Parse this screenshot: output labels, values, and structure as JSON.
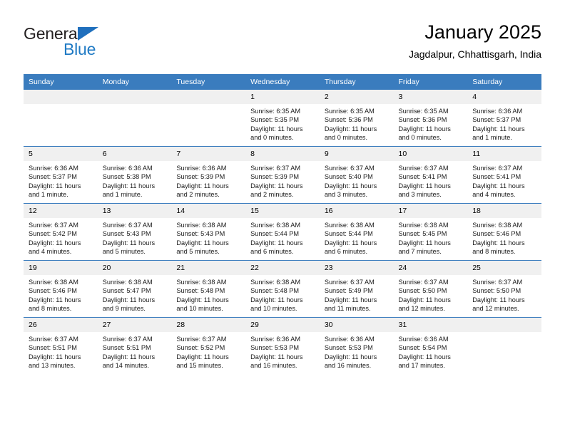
{
  "logo": {
    "word_top": "General",
    "word_bottom": "Blue",
    "triangle": "triangle-icon",
    "color_dark": "#231f20",
    "color_blue": "#1f7ac4"
  },
  "header": {
    "title": "January 2025",
    "subtitle": "Jagdalpur, Chhattisgarh, India"
  },
  "theme": {
    "header_bar": "#3a7cbe",
    "daynum_band": "#f0f0f0",
    "text": "#000000"
  },
  "weekday_headers": [
    "Sunday",
    "Monday",
    "Tuesday",
    "Wednesday",
    "Thursday",
    "Friday",
    "Saturday"
  ],
  "weeks": [
    [
      {
        "day": "",
        "sunrise": "",
        "sunset": "",
        "daylight1": "",
        "daylight2": ""
      },
      {
        "day": "",
        "sunrise": "",
        "sunset": "",
        "daylight1": "",
        "daylight2": ""
      },
      {
        "day": "",
        "sunrise": "",
        "sunset": "",
        "daylight1": "",
        "daylight2": ""
      },
      {
        "day": "1",
        "sunrise": "Sunrise: 6:35 AM",
        "sunset": "Sunset: 5:35 PM",
        "daylight1": "Daylight: 11 hours",
        "daylight2": "and 0 minutes."
      },
      {
        "day": "2",
        "sunrise": "Sunrise: 6:35 AM",
        "sunset": "Sunset: 5:36 PM",
        "daylight1": "Daylight: 11 hours",
        "daylight2": "and 0 minutes."
      },
      {
        "day": "3",
        "sunrise": "Sunrise: 6:35 AM",
        "sunset": "Sunset: 5:36 PM",
        "daylight1": "Daylight: 11 hours",
        "daylight2": "and 0 minutes."
      },
      {
        "day": "4",
        "sunrise": "Sunrise: 6:36 AM",
        "sunset": "Sunset: 5:37 PM",
        "daylight1": "Daylight: 11 hours",
        "daylight2": "and 1 minute."
      }
    ],
    [
      {
        "day": "5",
        "sunrise": "Sunrise: 6:36 AM",
        "sunset": "Sunset: 5:37 PM",
        "daylight1": "Daylight: 11 hours",
        "daylight2": "and 1 minute."
      },
      {
        "day": "6",
        "sunrise": "Sunrise: 6:36 AM",
        "sunset": "Sunset: 5:38 PM",
        "daylight1": "Daylight: 11 hours",
        "daylight2": "and 1 minute."
      },
      {
        "day": "7",
        "sunrise": "Sunrise: 6:36 AM",
        "sunset": "Sunset: 5:39 PM",
        "daylight1": "Daylight: 11 hours",
        "daylight2": "and 2 minutes."
      },
      {
        "day": "8",
        "sunrise": "Sunrise: 6:37 AM",
        "sunset": "Sunset: 5:39 PM",
        "daylight1": "Daylight: 11 hours",
        "daylight2": "and 2 minutes."
      },
      {
        "day": "9",
        "sunrise": "Sunrise: 6:37 AM",
        "sunset": "Sunset: 5:40 PM",
        "daylight1": "Daylight: 11 hours",
        "daylight2": "and 3 minutes."
      },
      {
        "day": "10",
        "sunrise": "Sunrise: 6:37 AM",
        "sunset": "Sunset: 5:41 PM",
        "daylight1": "Daylight: 11 hours",
        "daylight2": "and 3 minutes."
      },
      {
        "day": "11",
        "sunrise": "Sunrise: 6:37 AM",
        "sunset": "Sunset: 5:41 PM",
        "daylight1": "Daylight: 11 hours",
        "daylight2": "and 4 minutes."
      }
    ],
    [
      {
        "day": "12",
        "sunrise": "Sunrise: 6:37 AM",
        "sunset": "Sunset: 5:42 PM",
        "daylight1": "Daylight: 11 hours",
        "daylight2": "and 4 minutes."
      },
      {
        "day": "13",
        "sunrise": "Sunrise: 6:37 AM",
        "sunset": "Sunset: 5:43 PM",
        "daylight1": "Daylight: 11 hours",
        "daylight2": "and 5 minutes."
      },
      {
        "day": "14",
        "sunrise": "Sunrise: 6:38 AM",
        "sunset": "Sunset: 5:43 PM",
        "daylight1": "Daylight: 11 hours",
        "daylight2": "and 5 minutes."
      },
      {
        "day": "15",
        "sunrise": "Sunrise: 6:38 AM",
        "sunset": "Sunset: 5:44 PM",
        "daylight1": "Daylight: 11 hours",
        "daylight2": "and 6 minutes."
      },
      {
        "day": "16",
        "sunrise": "Sunrise: 6:38 AM",
        "sunset": "Sunset: 5:44 PM",
        "daylight1": "Daylight: 11 hours",
        "daylight2": "and 6 minutes."
      },
      {
        "day": "17",
        "sunrise": "Sunrise: 6:38 AM",
        "sunset": "Sunset: 5:45 PM",
        "daylight1": "Daylight: 11 hours",
        "daylight2": "and 7 minutes."
      },
      {
        "day": "18",
        "sunrise": "Sunrise: 6:38 AM",
        "sunset": "Sunset: 5:46 PM",
        "daylight1": "Daylight: 11 hours",
        "daylight2": "and 8 minutes."
      }
    ],
    [
      {
        "day": "19",
        "sunrise": "Sunrise: 6:38 AM",
        "sunset": "Sunset: 5:46 PM",
        "daylight1": "Daylight: 11 hours",
        "daylight2": "and 8 minutes."
      },
      {
        "day": "20",
        "sunrise": "Sunrise: 6:38 AM",
        "sunset": "Sunset: 5:47 PM",
        "daylight1": "Daylight: 11 hours",
        "daylight2": "and 9 minutes."
      },
      {
        "day": "21",
        "sunrise": "Sunrise: 6:38 AM",
        "sunset": "Sunset: 5:48 PM",
        "daylight1": "Daylight: 11 hours",
        "daylight2": "and 10 minutes."
      },
      {
        "day": "22",
        "sunrise": "Sunrise: 6:38 AM",
        "sunset": "Sunset: 5:48 PM",
        "daylight1": "Daylight: 11 hours",
        "daylight2": "and 10 minutes."
      },
      {
        "day": "23",
        "sunrise": "Sunrise: 6:37 AM",
        "sunset": "Sunset: 5:49 PM",
        "daylight1": "Daylight: 11 hours",
        "daylight2": "and 11 minutes."
      },
      {
        "day": "24",
        "sunrise": "Sunrise: 6:37 AM",
        "sunset": "Sunset: 5:50 PM",
        "daylight1": "Daylight: 11 hours",
        "daylight2": "and 12 minutes."
      },
      {
        "day": "25",
        "sunrise": "Sunrise: 6:37 AM",
        "sunset": "Sunset: 5:50 PM",
        "daylight1": "Daylight: 11 hours",
        "daylight2": "and 12 minutes."
      }
    ],
    [
      {
        "day": "26",
        "sunrise": "Sunrise: 6:37 AM",
        "sunset": "Sunset: 5:51 PM",
        "daylight1": "Daylight: 11 hours",
        "daylight2": "and 13 minutes."
      },
      {
        "day": "27",
        "sunrise": "Sunrise: 6:37 AM",
        "sunset": "Sunset: 5:51 PM",
        "daylight1": "Daylight: 11 hours",
        "daylight2": "and 14 minutes."
      },
      {
        "day": "28",
        "sunrise": "Sunrise: 6:37 AM",
        "sunset": "Sunset: 5:52 PM",
        "daylight1": "Daylight: 11 hours",
        "daylight2": "and 15 minutes."
      },
      {
        "day": "29",
        "sunrise": "Sunrise: 6:36 AM",
        "sunset": "Sunset: 5:53 PM",
        "daylight1": "Daylight: 11 hours",
        "daylight2": "and 16 minutes."
      },
      {
        "day": "30",
        "sunrise": "Sunrise: 6:36 AM",
        "sunset": "Sunset: 5:53 PM",
        "daylight1": "Daylight: 11 hours",
        "daylight2": "and 16 minutes."
      },
      {
        "day": "31",
        "sunrise": "Sunrise: 6:36 AM",
        "sunset": "Sunset: 5:54 PM",
        "daylight1": "Daylight: 11 hours",
        "daylight2": "and 17 minutes."
      },
      {
        "day": "",
        "sunrise": "",
        "sunset": "",
        "daylight1": "",
        "daylight2": ""
      }
    ]
  ]
}
